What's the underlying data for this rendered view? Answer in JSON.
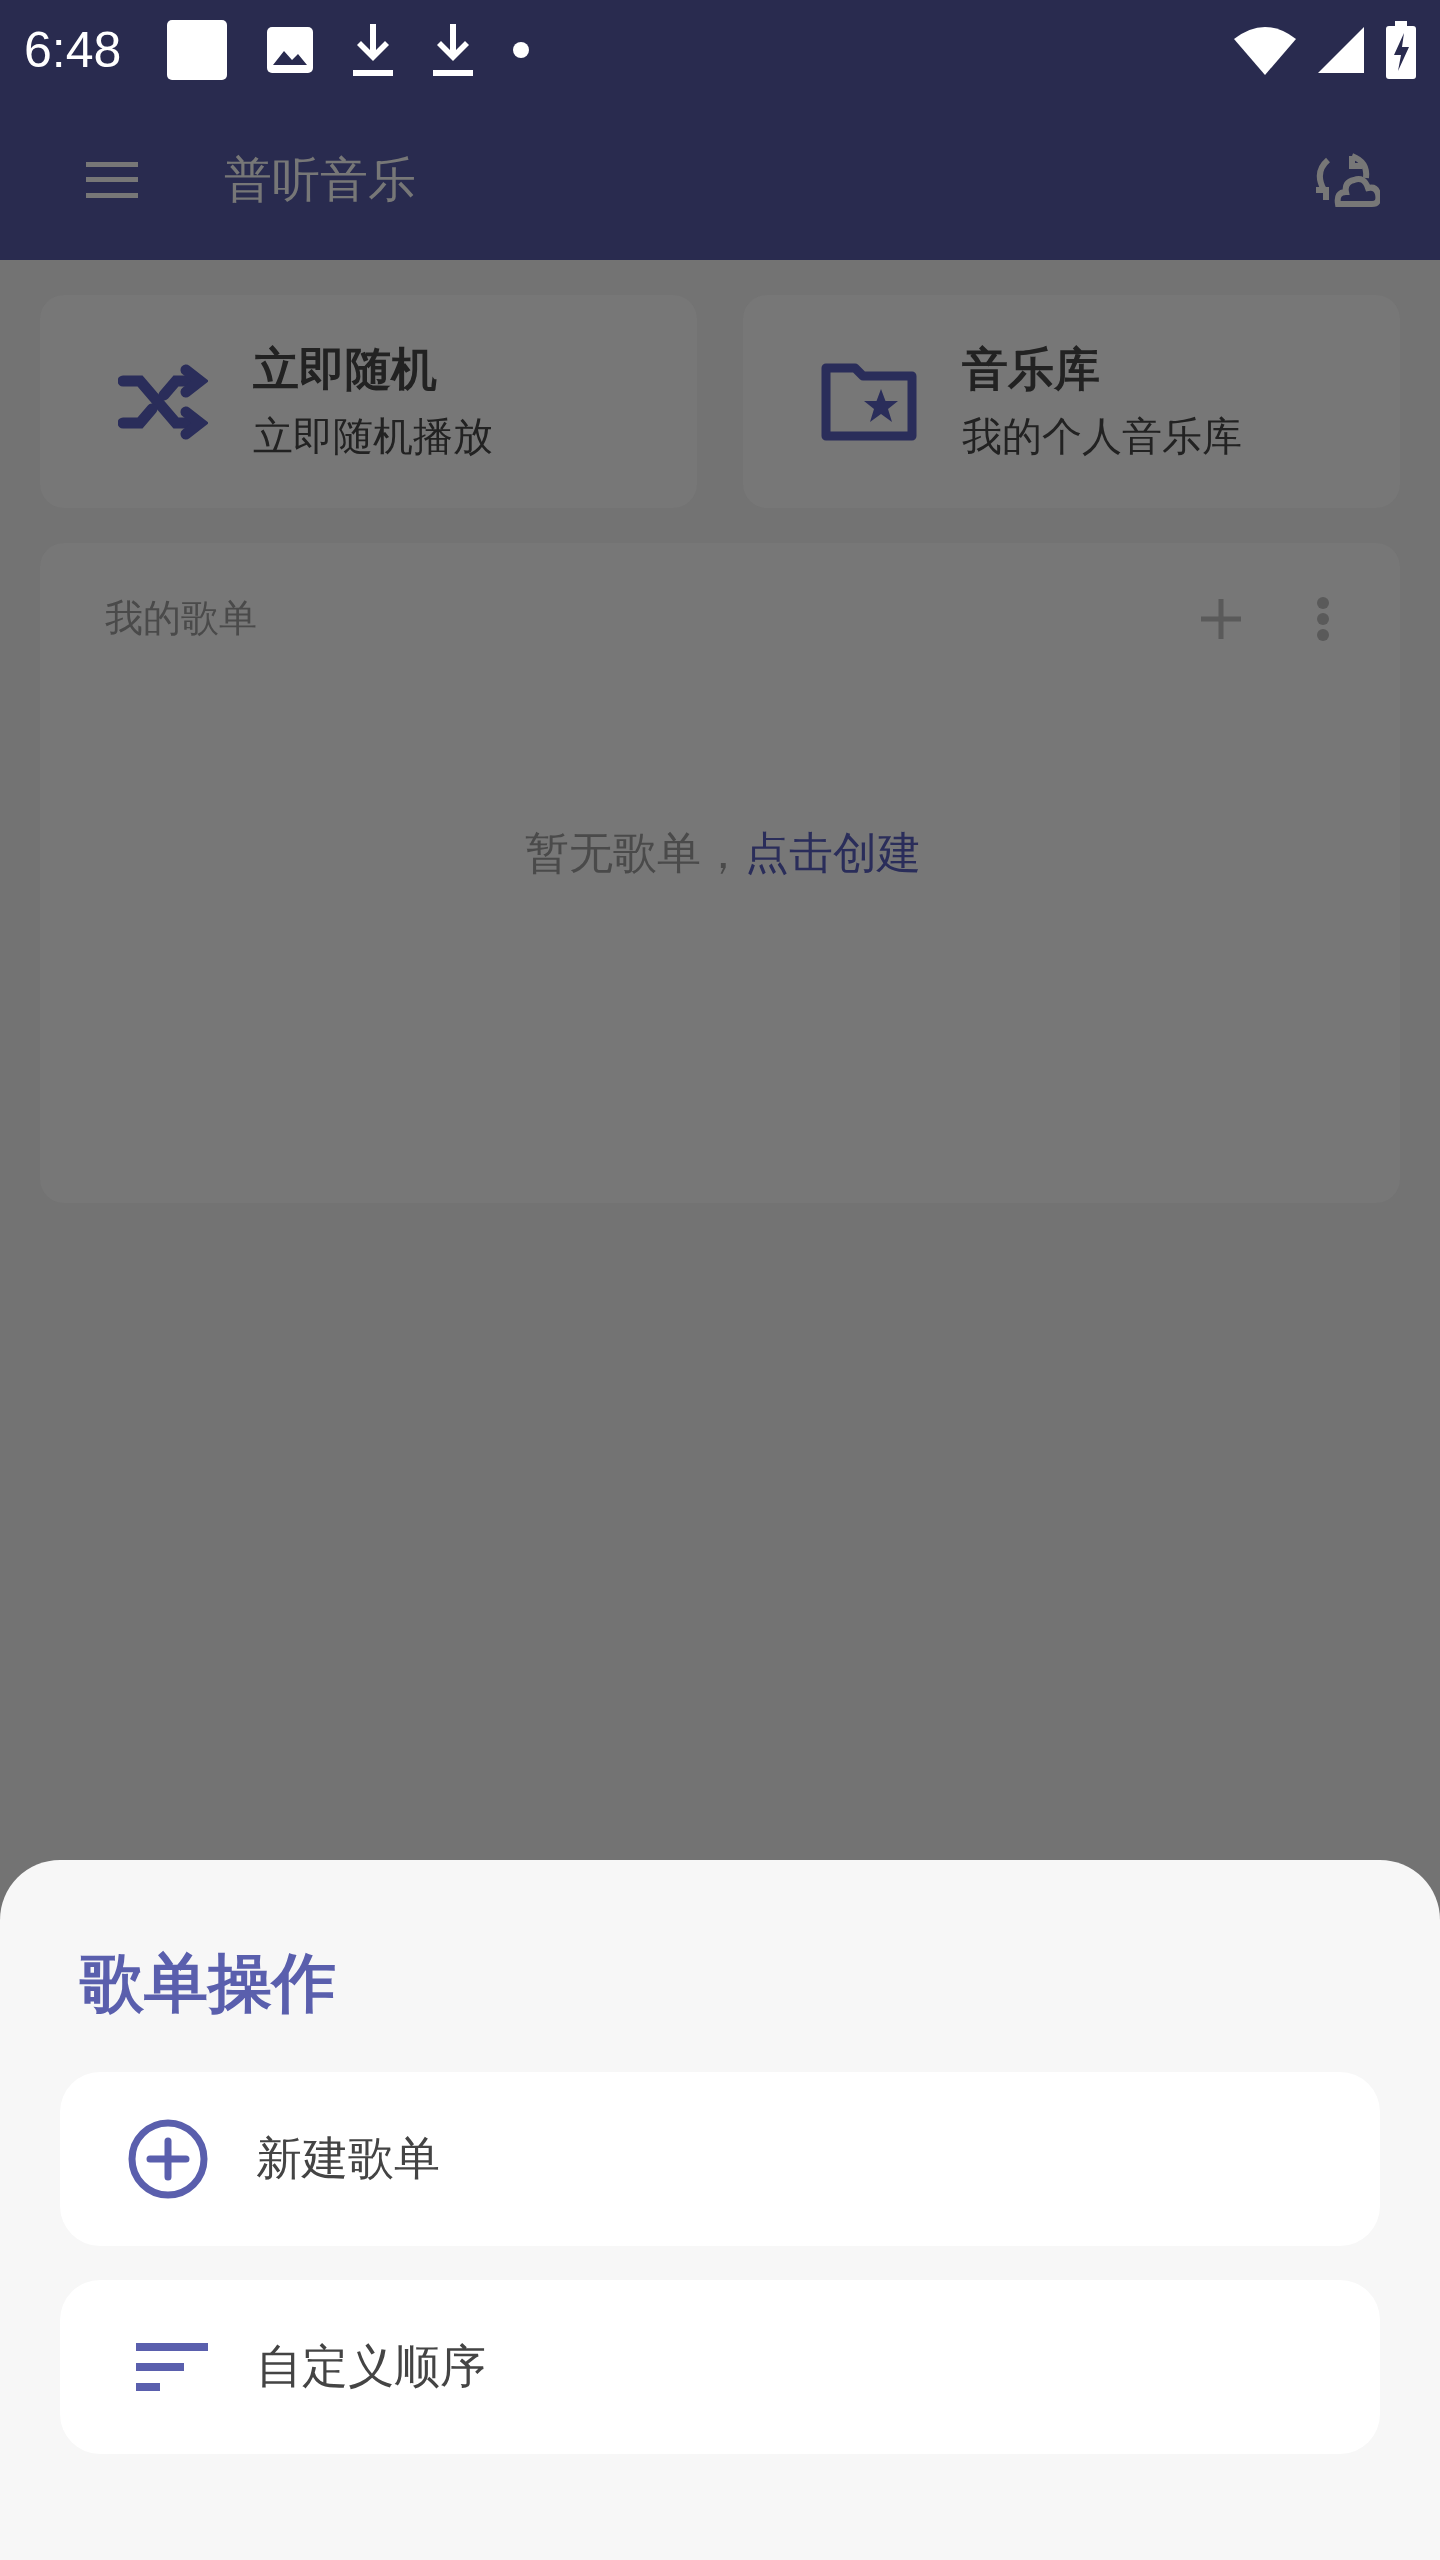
{
  "status_bar": {
    "time": "6:48"
  },
  "app_bar": {
    "title": "普听音乐"
  },
  "cards": [
    {
      "title": "立即随机",
      "subtitle": "立即随机播放"
    },
    {
      "title": "音乐库",
      "subtitle": "我的个人音乐库"
    }
  ],
  "playlists": {
    "title": "我的歌单",
    "empty_text": "暂无歌单，",
    "create_link": "点击创建"
  },
  "sheet": {
    "title": "歌单操作",
    "items": [
      {
        "label": "新建歌单"
      },
      {
        "label": "自定义顺序"
      }
    ]
  }
}
